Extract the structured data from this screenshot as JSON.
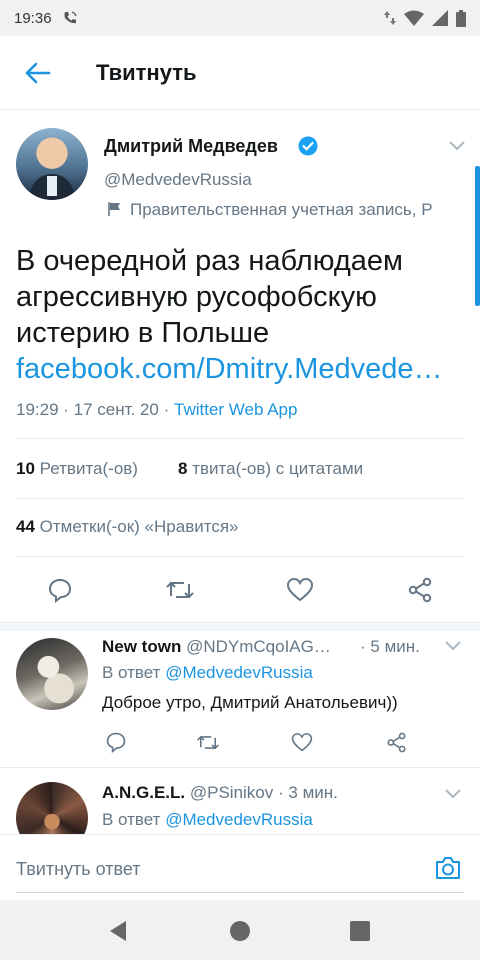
{
  "status_bar": {
    "time": "19:36"
  },
  "header": {
    "title": "Твитнуть"
  },
  "tweet": {
    "author_name": "Дмитрий Медведев",
    "author_handle": "@MedvedevRussia",
    "account_label": "Правительственная учетная запись, Р",
    "text_lines": [
      "В очередной раз наблюдаем",
      "агрессивную русофобскую",
      "истерию в Польше"
    ],
    "link": "facebook.com/Dmitry.Medvede…",
    "time": "19:29",
    "date": "17 сент. 20",
    "source": "Twitter Web App",
    "retweets_count": "10",
    "retweets_label": "Ретвита(-ов)",
    "quotes_count": "8",
    "quotes_label": "твита(-ов) с цитатами",
    "likes_count": "44",
    "likes_label": "Отметки(-ок) «Нравится»"
  },
  "replies": [
    {
      "name": "New town",
      "handle": "@NDYmCqoIAG…",
      "time": "5 мин.",
      "reply_to_prefix": "В ответ",
      "reply_to": "@MedvedevRussia",
      "text": "Доброе утро, Дмитрий Анатольевич))"
    },
    {
      "name": "A.N.G.E.L.",
      "handle": "@PSinikov",
      "time": "3 мин.",
      "reply_to_prefix": "В ответ",
      "reply_to": "@MedvedevRussia"
    }
  ],
  "compose": {
    "placeholder": "Твитнуть ответ"
  },
  "colors": {
    "accent": "#1b95e0",
    "muted": "#657786",
    "verified": "#1da1f2"
  }
}
